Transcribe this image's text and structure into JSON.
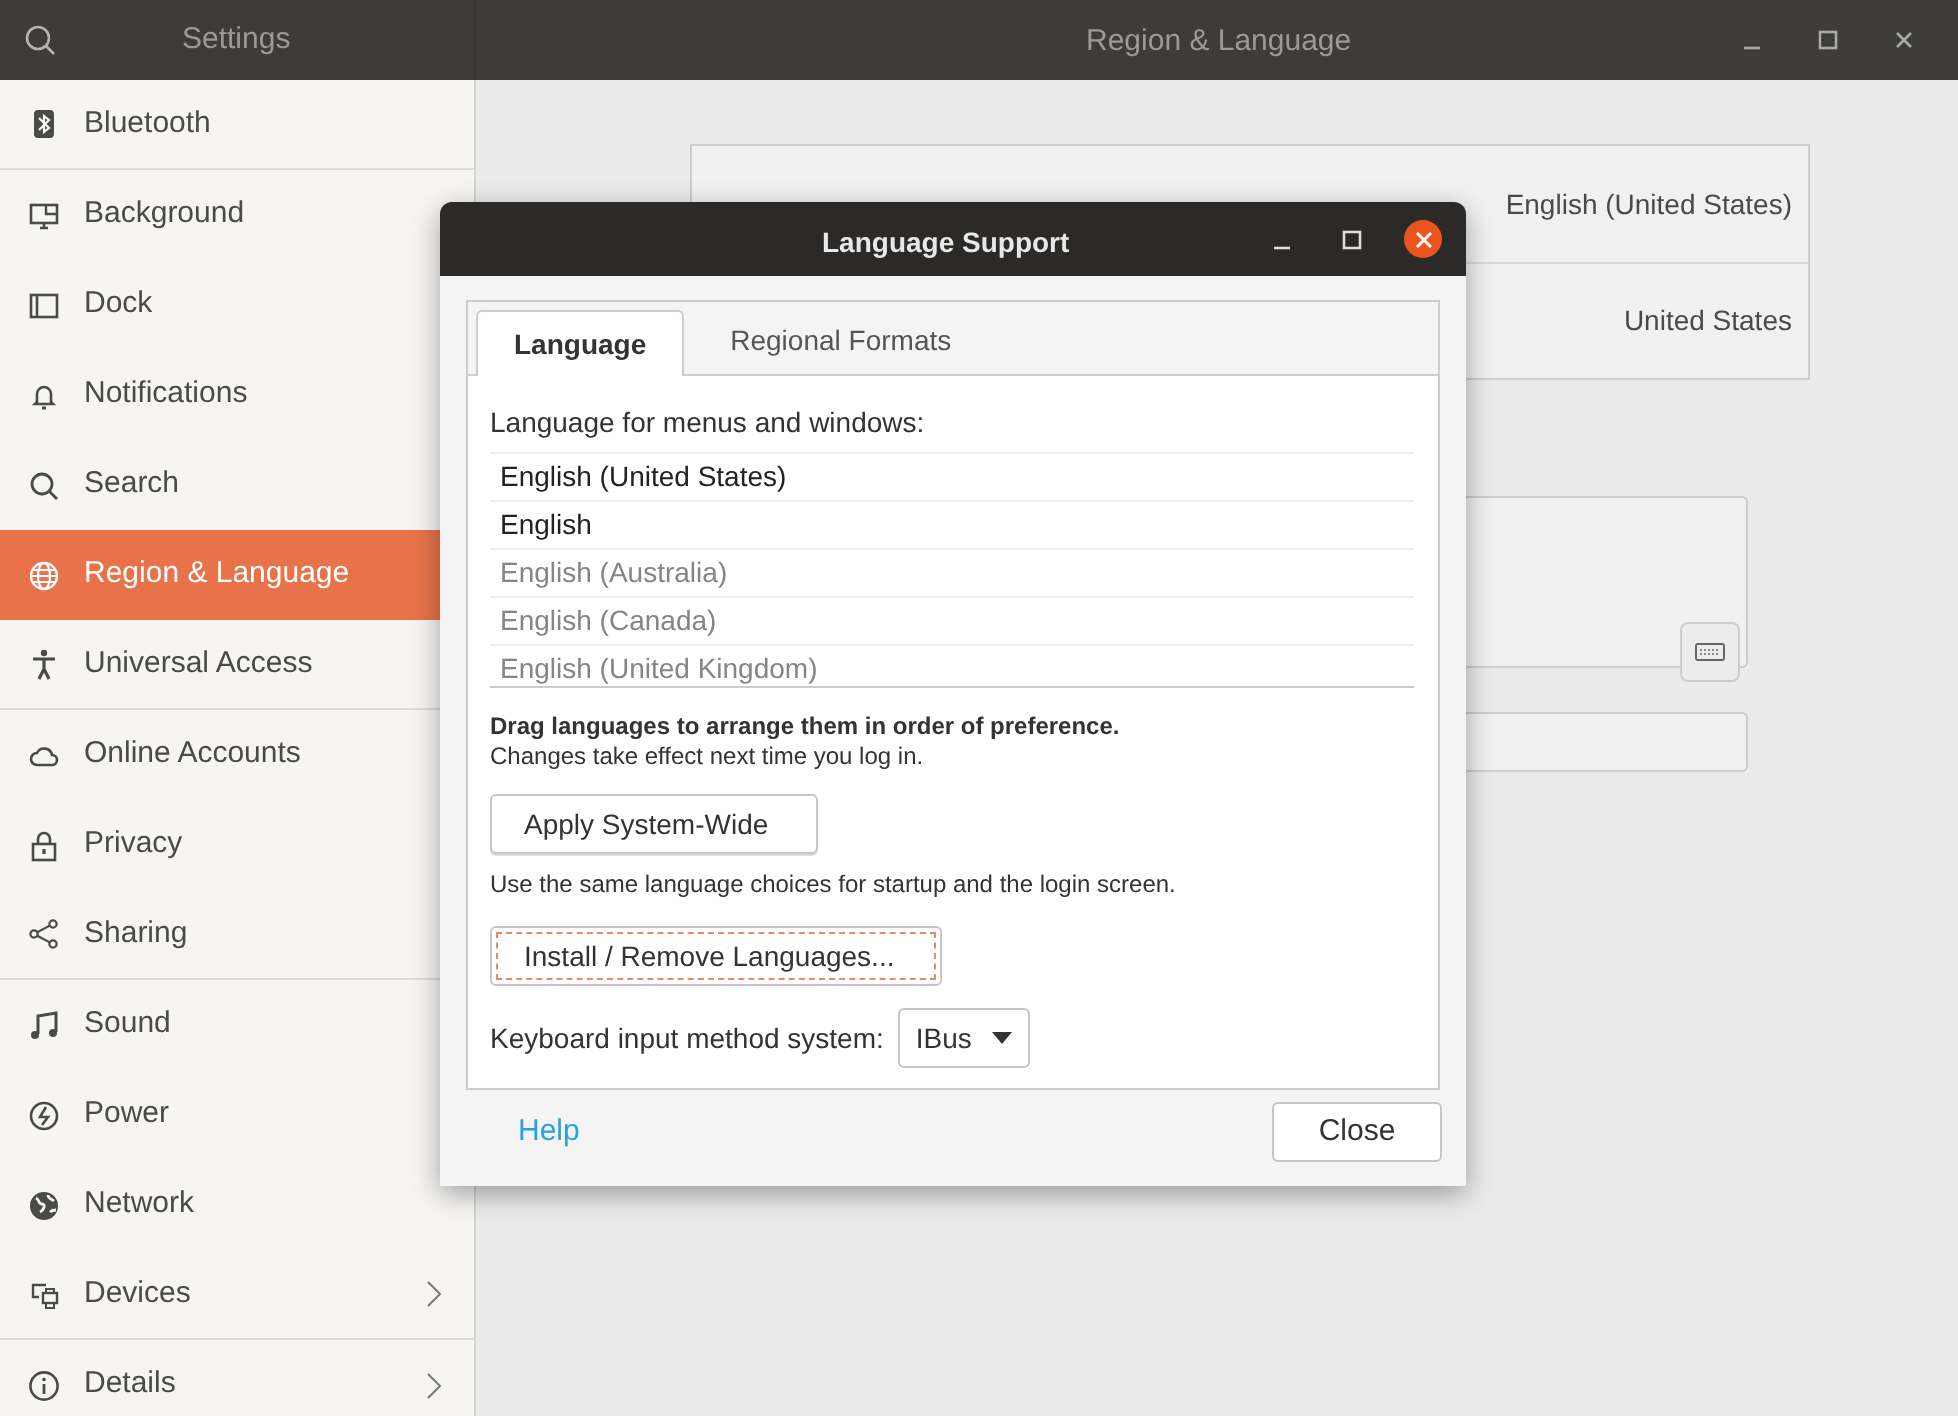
{
  "window": {
    "sidebar_title": "Settings",
    "title": "Region & Language"
  },
  "sidebar": {
    "items": [
      {
        "label": "Bluetooth",
        "selected": false,
        "chevron": false,
        "divider": true
      },
      {
        "label": "Background",
        "selected": false,
        "chevron": false,
        "divider": false
      },
      {
        "label": "Dock",
        "selected": false,
        "chevron": false,
        "divider": false
      },
      {
        "label": "Notifications",
        "selected": false,
        "chevron": false,
        "divider": false
      },
      {
        "label": "Search",
        "selected": false,
        "chevron": false,
        "divider": false
      },
      {
        "label": "Region & Language",
        "selected": true,
        "chevron": false,
        "divider": false
      },
      {
        "label": "Universal Access",
        "selected": false,
        "chevron": false,
        "divider": true
      },
      {
        "label": "Online Accounts",
        "selected": false,
        "chevron": false,
        "divider": false
      },
      {
        "label": "Privacy",
        "selected": false,
        "chevron": false,
        "divider": false
      },
      {
        "label": "Sharing",
        "selected": false,
        "chevron": false,
        "divider": true
      },
      {
        "label": "Sound",
        "selected": false,
        "chevron": false,
        "divider": false
      },
      {
        "label": "Power",
        "selected": false,
        "chevron": false,
        "divider": false
      },
      {
        "label": "Network",
        "selected": false,
        "chevron": false,
        "divider": false
      },
      {
        "label": "Devices",
        "selected": false,
        "chevron": true,
        "divider": true
      },
      {
        "label": "Details",
        "selected": false,
        "chevron": true,
        "divider": false
      }
    ]
  },
  "region_panel": {
    "rows": [
      {
        "value": "English (United States)"
      },
      {
        "value": "United States"
      }
    ]
  },
  "dialog": {
    "title": "Language Support",
    "tabs": [
      {
        "label": "Language",
        "selected": true
      },
      {
        "label": "Regional Formats",
        "selected": false
      }
    ],
    "list_label": "Language for menus and windows:",
    "languages": [
      {
        "name": "English (United States)",
        "dimmed": false
      },
      {
        "name": "English",
        "dimmed": false
      },
      {
        "name": "English (Australia)",
        "dimmed": true
      },
      {
        "name": "English (Canada)",
        "dimmed": true
      },
      {
        "name": "English (United Kingdom)",
        "dimmed": true
      }
    ],
    "drag_hint": "Drag languages to arrange them in order of preference.",
    "changes_note": "Changes take effect next time you log in.",
    "apply_button": "Apply System-Wide",
    "apply_note": "Use the same language choices for startup and the login screen.",
    "install_button": {
      "label": "Install / Remove Languages...",
      "focused": true
    },
    "input_method": {
      "label": "Keyboard input method system:",
      "value": "IBus"
    },
    "help_link": "Help",
    "close_button": "Close"
  }
}
